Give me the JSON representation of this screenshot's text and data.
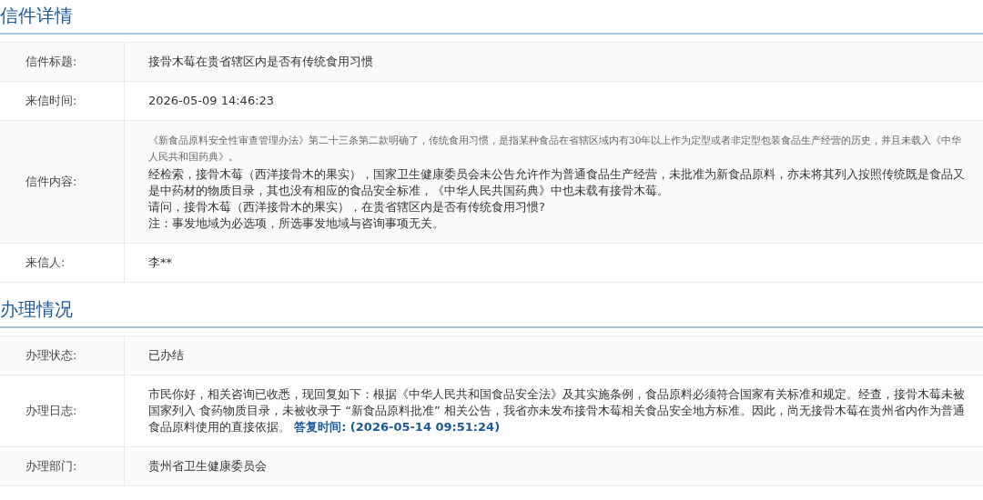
{
  "sections": [
    {
      "title": "信件详情",
      "rows": [
        {
          "label": "信件标题:",
          "paragraphs": [
            {
              "kind": "text",
              "text": "接骨木莓在贵省辖区内是否有传统食用习惯"
            }
          ]
        },
        {
          "label": "来信时间:",
          "paragraphs": [
            {
              "kind": "text",
              "text": "2026-05-09 14:46:23"
            }
          ]
        },
        {
          "label": "信件内容:",
          "paragraphs": [
            {
              "kind": "quote",
              "text": "《新食品原料安全性审查管理办法》第二十三条第二款明确了，传统食用习惯，是指某种食品在省辖区域内有30年以上作为定型或者非定型包装食品生产经营的历史，并且未载入《中华人民共和国药典》。"
            },
            {
              "kind": "text",
              "text": "经检索，接骨木莓（西洋接骨木的果实），国家卫生健康委员会未公告允许作为普通食品生产经营，未批准为新食品原料，亦未将其列入按照传统既是食品又是中药材的物质目录，其也没有相应的食品安全标准，《中华人民共国药典》中也未载有接骨木莓。"
            },
            {
              "kind": "text",
              "text": "请问，接骨木莓（西洋接骨木的果实），在贵省辖区内是否有传统食用习惯?"
            },
            {
              "kind": "text",
              "text": "注：事发地域为必选项，所选事发地域与咨询事项无关。"
            }
          ]
        },
        {
          "label": "来信人:",
          "paragraphs": [
            {
              "kind": "text",
              "text": "李**"
            }
          ]
        }
      ]
    },
    {
      "title": "办理情况",
      "rows": [
        {
          "label": "办理状态:",
          "paragraphs": [
            {
              "kind": "text",
              "text": "已办结"
            }
          ]
        },
        {
          "label": "办理日志:",
          "paragraphs": [
            {
              "kind": "text",
              "text": "市民你好，相关咨询已收悉，现回复如下：根据《中华人民共和国食品安全法》及其实施条例，食品原料必须符合国家有关标准和规定。经查，接骨木莓未被国家列入  食药物质目录，未被收录于 “新食品原料批准” 相关公告，我省亦未发布接骨木莓相关食品安全地方标准。因此，尚无接骨木莓在贵州省内作为普通食品原料使用的直接依据。 **答复时间: (2026-05-14 09:51:24)**"
            }
          ]
        },
        {
          "label": "办理部门:",
          "paragraphs": [
            {
              "kind": "text",
              "text": "贵州省卫生健康委员会"
            }
          ]
        }
      ]
    }
  ]
}
